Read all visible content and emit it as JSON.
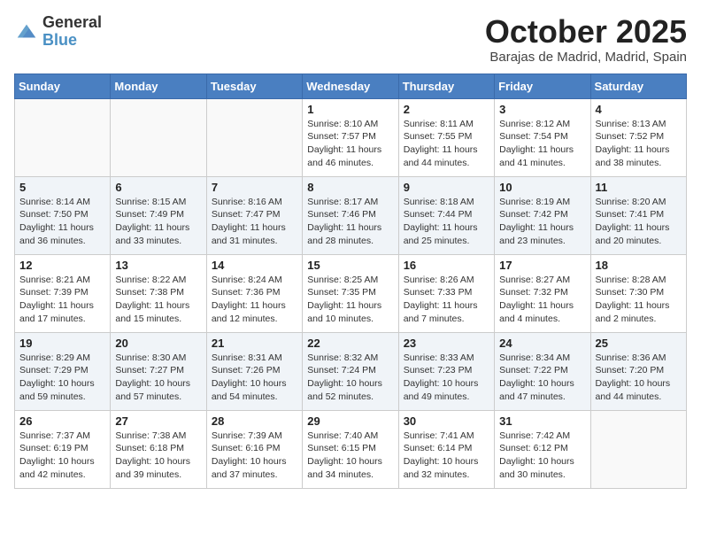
{
  "logo": {
    "general": "General",
    "blue": "Blue"
  },
  "header": {
    "month": "October 2025",
    "location": "Barajas de Madrid, Madrid, Spain"
  },
  "days_of_week": [
    "Sunday",
    "Monday",
    "Tuesday",
    "Wednesday",
    "Thursday",
    "Friday",
    "Saturday"
  ],
  "weeks": [
    [
      {
        "day": "",
        "info": ""
      },
      {
        "day": "",
        "info": ""
      },
      {
        "day": "",
        "info": ""
      },
      {
        "day": "1",
        "info": "Sunrise: 8:10 AM\nSunset: 7:57 PM\nDaylight: 11 hours and 46 minutes."
      },
      {
        "day": "2",
        "info": "Sunrise: 8:11 AM\nSunset: 7:55 PM\nDaylight: 11 hours and 44 minutes."
      },
      {
        "day": "3",
        "info": "Sunrise: 8:12 AM\nSunset: 7:54 PM\nDaylight: 11 hours and 41 minutes."
      },
      {
        "day": "4",
        "info": "Sunrise: 8:13 AM\nSunset: 7:52 PM\nDaylight: 11 hours and 38 minutes."
      }
    ],
    [
      {
        "day": "5",
        "info": "Sunrise: 8:14 AM\nSunset: 7:50 PM\nDaylight: 11 hours and 36 minutes."
      },
      {
        "day": "6",
        "info": "Sunrise: 8:15 AM\nSunset: 7:49 PM\nDaylight: 11 hours and 33 minutes."
      },
      {
        "day": "7",
        "info": "Sunrise: 8:16 AM\nSunset: 7:47 PM\nDaylight: 11 hours and 31 minutes."
      },
      {
        "day": "8",
        "info": "Sunrise: 8:17 AM\nSunset: 7:46 PM\nDaylight: 11 hours and 28 minutes."
      },
      {
        "day": "9",
        "info": "Sunrise: 8:18 AM\nSunset: 7:44 PM\nDaylight: 11 hours and 25 minutes."
      },
      {
        "day": "10",
        "info": "Sunrise: 8:19 AM\nSunset: 7:42 PM\nDaylight: 11 hours and 23 minutes."
      },
      {
        "day": "11",
        "info": "Sunrise: 8:20 AM\nSunset: 7:41 PM\nDaylight: 11 hours and 20 minutes."
      }
    ],
    [
      {
        "day": "12",
        "info": "Sunrise: 8:21 AM\nSunset: 7:39 PM\nDaylight: 11 hours and 17 minutes."
      },
      {
        "day": "13",
        "info": "Sunrise: 8:22 AM\nSunset: 7:38 PM\nDaylight: 11 hours and 15 minutes."
      },
      {
        "day": "14",
        "info": "Sunrise: 8:24 AM\nSunset: 7:36 PM\nDaylight: 11 hours and 12 minutes."
      },
      {
        "day": "15",
        "info": "Sunrise: 8:25 AM\nSunset: 7:35 PM\nDaylight: 11 hours and 10 minutes."
      },
      {
        "day": "16",
        "info": "Sunrise: 8:26 AM\nSunset: 7:33 PM\nDaylight: 11 hours and 7 minutes."
      },
      {
        "day": "17",
        "info": "Sunrise: 8:27 AM\nSunset: 7:32 PM\nDaylight: 11 hours and 4 minutes."
      },
      {
        "day": "18",
        "info": "Sunrise: 8:28 AM\nSunset: 7:30 PM\nDaylight: 11 hours and 2 minutes."
      }
    ],
    [
      {
        "day": "19",
        "info": "Sunrise: 8:29 AM\nSunset: 7:29 PM\nDaylight: 10 hours and 59 minutes."
      },
      {
        "day": "20",
        "info": "Sunrise: 8:30 AM\nSunset: 7:27 PM\nDaylight: 10 hours and 57 minutes."
      },
      {
        "day": "21",
        "info": "Sunrise: 8:31 AM\nSunset: 7:26 PM\nDaylight: 10 hours and 54 minutes."
      },
      {
        "day": "22",
        "info": "Sunrise: 8:32 AM\nSunset: 7:24 PM\nDaylight: 10 hours and 52 minutes."
      },
      {
        "day": "23",
        "info": "Sunrise: 8:33 AM\nSunset: 7:23 PM\nDaylight: 10 hours and 49 minutes."
      },
      {
        "day": "24",
        "info": "Sunrise: 8:34 AM\nSunset: 7:22 PM\nDaylight: 10 hours and 47 minutes."
      },
      {
        "day": "25",
        "info": "Sunrise: 8:36 AM\nSunset: 7:20 PM\nDaylight: 10 hours and 44 minutes."
      }
    ],
    [
      {
        "day": "26",
        "info": "Sunrise: 7:37 AM\nSunset: 6:19 PM\nDaylight: 10 hours and 42 minutes."
      },
      {
        "day": "27",
        "info": "Sunrise: 7:38 AM\nSunset: 6:18 PM\nDaylight: 10 hours and 39 minutes."
      },
      {
        "day": "28",
        "info": "Sunrise: 7:39 AM\nSunset: 6:16 PM\nDaylight: 10 hours and 37 minutes."
      },
      {
        "day": "29",
        "info": "Sunrise: 7:40 AM\nSunset: 6:15 PM\nDaylight: 10 hours and 34 minutes."
      },
      {
        "day": "30",
        "info": "Sunrise: 7:41 AM\nSunset: 6:14 PM\nDaylight: 10 hours and 32 minutes."
      },
      {
        "day": "31",
        "info": "Sunrise: 7:42 AM\nSunset: 6:12 PM\nDaylight: 10 hours and 30 minutes."
      },
      {
        "day": "",
        "info": ""
      }
    ]
  ]
}
